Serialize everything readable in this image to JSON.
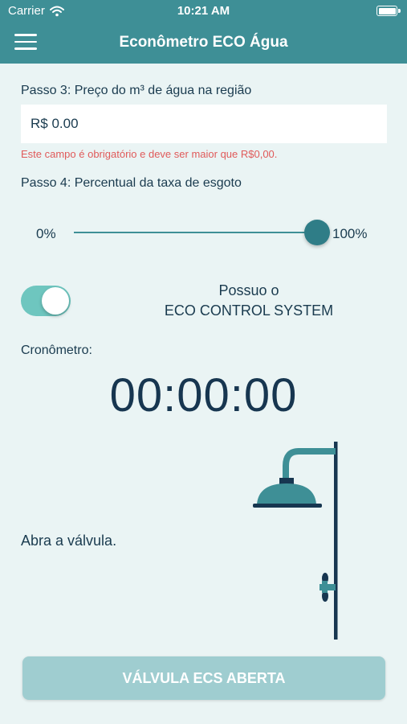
{
  "status_bar": {
    "carrier": "Carrier",
    "time": "10:21 AM"
  },
  "header": {
    "title": "Econômetro ECO Água"
  },
  "step3": {
    "label": "Passo 3: Preço do m³ de água na região",
    "value": "R$ 0.00",
    "error": "Este campo é obrigatório e deve ser maior que R$0,00."
  },
  "step4": {
    "label": "Passo 4: Percentual da taxa de esgoto",
    "min_label": "0%",
    "max_label": "100%",
    "value": 1.0
  },
  "eco_toggle": {
    "on": true,
    "label_line1": "Possuo o",
    "label_line2": "ECO CONTROL SYSTEM"
  },
  "timer": {
    "label": "Cronômetro:",
    "value": "00:00:00"
  },
  "instruction": "Abra a válvula.",
  "action_button": {
    "label": "VÁLVULA ECS ABERTA"
  },
  "colors": {
    "accent": "#3e8f96",
    "dark": "#173650",
    "error": "#e05a5a",
    "toggle_on": "#6ec6bf",
    "button_disabled": "#9fcdd0"
  }
}
